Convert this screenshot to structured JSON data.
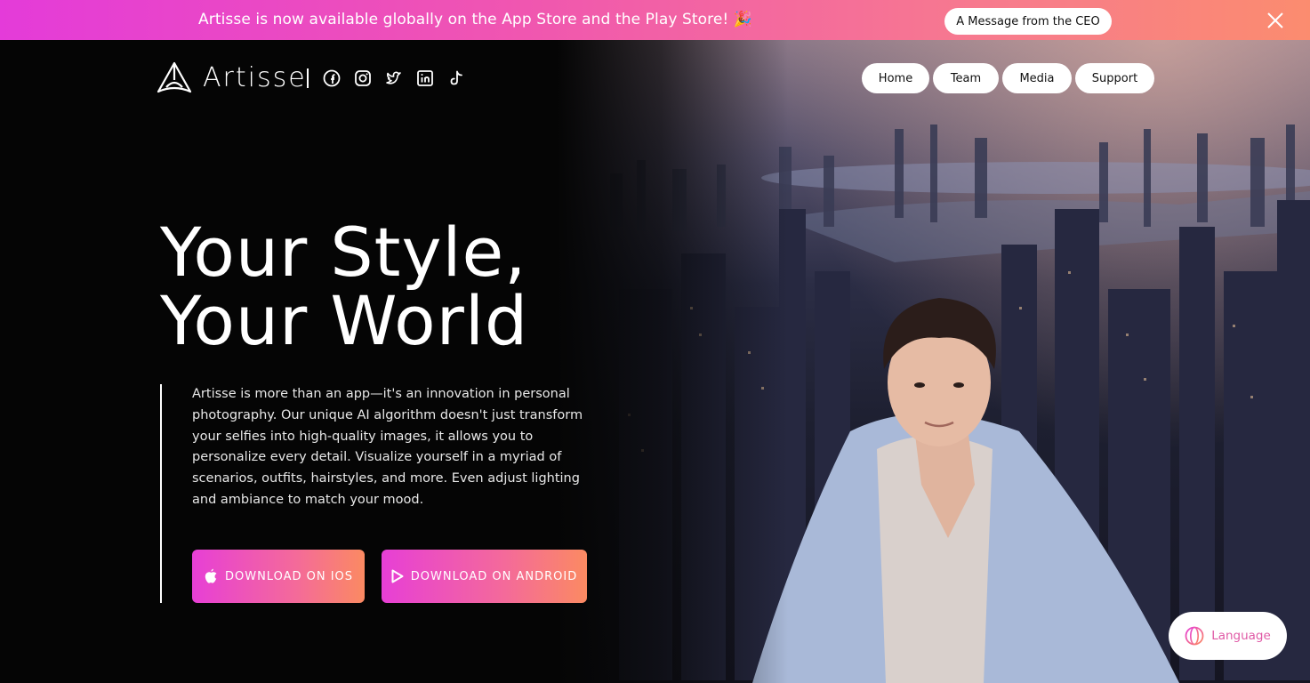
{
  "banner": {
    "text": "Artisse is now available globally on the App Store and the Play Store! 🎉",
    "ceo_button": "A Message from the CEO"
  },
  "header": {
    "brand": "Artisse",
    "social_icons": [
      "facebook-icon",
      "instagram-icon",
      "twitter-icon",
      "linkedin-icon",
      "tiktok-icon"
    ],
    "nav": [
      "Home",
      "Team",
      "Media",
      "Support"
    ]
  },
  "hero": {
    "headline_line1": "Your Style,",
    "headline_line2": "Your World",
    "description": "Artisse is more than an app—it's an innovation in personal photography. Our unique AI algorithm doesn't just transform your selfies into high-quality images, it allows you to personalize every detail. Visualize yourself in a myriad of scenarios, outfits, hairstyles, and more. Even adjust lighting and ambiance to match your mood.",
    "ios_button": "DOWNLOAD ON IOS",
    "android_button": "DOWNLOAD ON ANDROID"
  },
  "language_button": "Language",
  "colors": {
    "gradient_start": "#e43bd9",
    "gradient_end": "#fb8c6f",
    "background": "#050505"
  }
}
